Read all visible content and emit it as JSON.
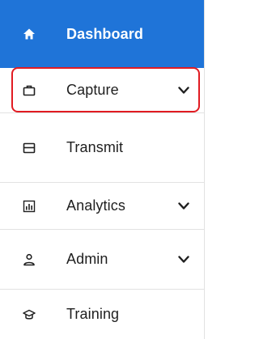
{
  "nav": {
    "items": [
      {
        "label": "Dashboard",
        "icon": "home-icon",
        "active": true,
        "expandable": false
      },
      {
        "label": "Capture",
        "icon": "briefcase-icon",
        "active": false,
        "expandable": true
      },
      {
        "label": "Transmit",
        "icon": "card-icon",
        "active": false,
        "expandable": false
      },
      {
        "label": "Analytics",
        "icon": "bar-chart-icon",
        "active": false,
        "expandable": true
      },
      {
        "label": "Admin",
        "icon": "user-icon",
        "active": false,
        "expandable": true
      },
      {
        "label": "Training",
        "icon": "graduation-cap-icon",
        "active": false,
        "expandable": false
      }
    ]
  },
  "colors": {
    "active_background": "#1f74d8",
    "highlight_border": "#e11b22",
    "divider": "#e2e2e2"
  }
}
